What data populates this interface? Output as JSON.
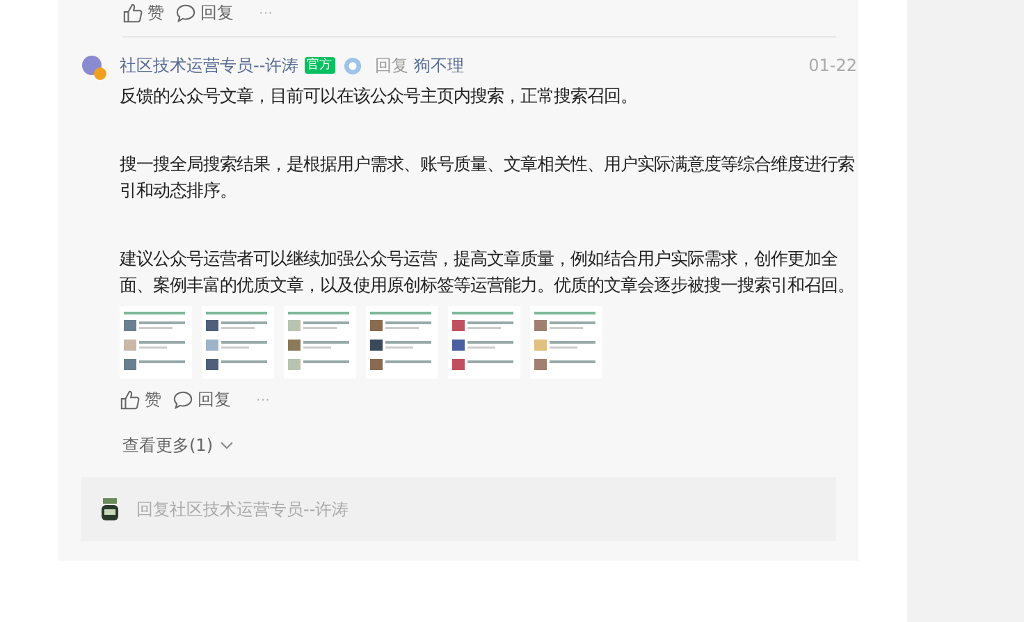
{
  "previous_actions": {
    "like": "赞",
    "reply": "回复",
    "more": "···"
  },
  "comment": {
    "author": "社区技术运营专员--许涛",
    "badge": "官方",
    "reply_label": "回复",
    "reply_to": "狗不理",
    "date": "01-22",
    "paragraphs": [
      "反馈的公众号文章，目前可以在该公众号主页内搜索，正常搜索召回。",
      "搜一搜全局搜索结果，是根据用户需求、账号质量、文章相关性、用户实际满意度等综合维度进行索引和动态排序。",
      "建议公众号运营者可以继续加强公众号运营，提高文章质量，例如结合用户实际需求，创作更加全面、案例丰富的优质文章，以及使用原创标签等运营能力。优质的文章会逐步被搜一搜索引和召回。"
    ],
    "actions": {
      "like": "赞",
      "reply": "回复",
      "more": "···"
    }
  },
  "show_more": "查看更多(1)",
  "reply_box": {
    "placeholder": "回复社区技术运营专员--许涛"
  }
}
